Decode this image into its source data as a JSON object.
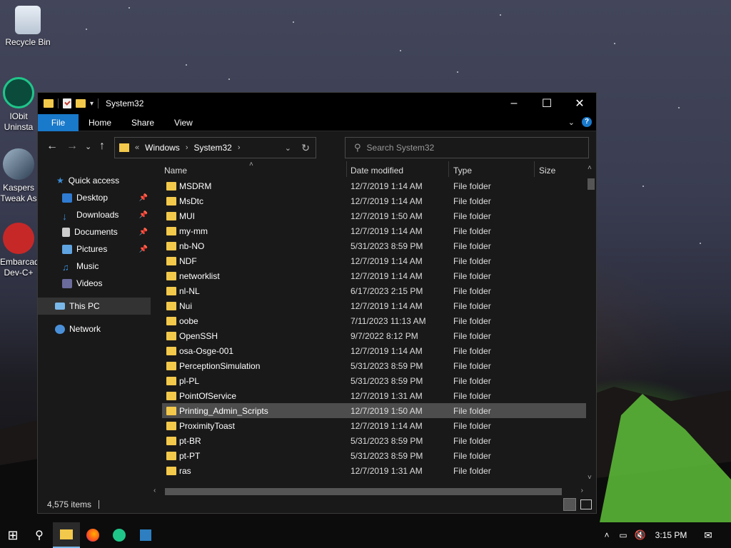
{
  "desktop": {
    "icons": [
      {
        "label": "Recycle Bin",
        "icon": "recycle-bin-icon"
      },
      {
        "label": "IObit Uninsta",
        "icon": "iobit-uninstaller-icon"
      },
      {
        "label": "Kaspers Tweak As",
        "icon": "kaspersky-tweak-icon"
      },
      {
        "label": "Embarcad Dev-C+",
        "icon": "devcpp-icon"
      }
    ]
  },
  "window": {
    "title": "System32",
    "ribbon": {
      "file": "File",
      "home": "Home",
      "share": "Share",
      "view": "View"
    },
    "address": {
      "crumb1": "Windows",
      "crumb2": "System32",
      "prefix": "«"
    },
    "search": {
      "placeholder": "Search System32"
    },
    "nav": {
      "quick_access": "Quick access",
      "desktop": "Desktop",
      "downloads": "Downloads",
      "documents": "Documents",
      "pictures": "Pictures",
      "music": "Music",
      "videos": "Videos",
      "this_pc": "This PC",
      "network": "Network"
    },
    "columns": {
      "name": "Name",
      "date": "Date modified",
      "type": "Type",
      "size": "Size"
    },
    "files": [
      {
        "name": "MSDRM",
        "date": "12/7/2019 1:14 AM",
        "type": "File folder"
      },
      {
        "name": "MsDtc",
        "date": "12/7/2019 1:14 AM",
        "type": "File folder"
      },
      {
        "name": "MUI",
        "date": "12/7/2019 1:50 AM",
        "type": "File folder"
      },
      {
        "name": "my-mm",
        "date": "12/7/2019 1:14 AM",
        "type": "File folder"
      },
      {
        "name": "nb-NO",
        "date": "5/31/2023 8:59 PM",
        "type": "File folder"
      },
      {
        "name": "NDF",
        "date": "12/7/2019 1:14 AM",
        "type": "File folder"
      },
      {
        "name": "networklist",
        "date": "12/7/2019 1:14 AM",
        "type": "File folder"
      },
      {
        "name": "nl-NL",
        "date": "6/17/2023 2:15 PM",
        "type": "File folder"
      },
      {
        "name": "Nui",
        "date": "12/7/2019 1:14 AM",
        "type": "File folder"
      },
      {
        "name": "oobe",
        "date": "7/11/2023 11:13 AM",
        "type": "File folder"
      },
      {
        "name": "OpenSSH",
        "date": "9/7/2022 8:12 PM",
        "type": "File folder"
      },
      {
        "name": "osa-Osge-001",
        "date": "12/7/2019 1:14 AM",
        "type": "File folder"
      },
      {
        "name": "PerceptionSimulation",
        "date": "5/31/2023 8:59 PM",
        "type": "File folder"
      },
      {
        "name": "pl-PL",
        "date": "5/31/2023 8:59 PM",
        "type": "File folder"
      },
      {
        "name": "PointOfService",
        "date": "12/7/2019 1:31 AM",
        "type": "File folder"
      },
      {
        "name": "Printing_Admin_Scripts",
        "date": "12/7/2019 1:50 AM",
        "type": "File folder",
        "selected": true
      },
      {
        "name": "ProximityToast",
        "date": "12/7/2019 1:14 AM",
        "type": "File folder"
      },
      {
        "name": "pt-BR",
        "date": "5/31/2023 8:59 PM",
        "type": "File folder"
      },
      {
        "name": "pt-PT",
        "date": "5/31/2023 8:59 PM",
        "type": "File folder"
      },
      {
        "name": "ras",
        "date": "12/7/2019 1:31 AM",
        "type": "File folder"
      }
    ],
    "status": {
      "count": "4,575 items"
    }
  },
  "taskbar": {
    "time": "3:15 PM",
    "apps": [
      "start-icon",
      "search-icon",
      "file-explorer-icon",
      "firefox-icon",
      "iobit-icon",
      "devcpp-icon"
    ]
  },
  "colors": {
    "accent": "#1979ca",
    "folder": "#f3c94b",
    "selection": "#4d4d4d"
  }
}
